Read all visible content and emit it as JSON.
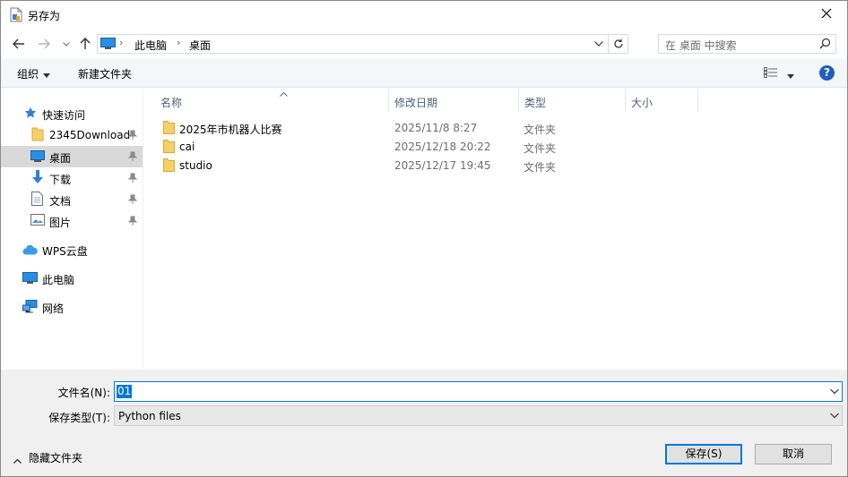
{
  "window": {
    "title": "另存为",
    "close_glyph": "✕"
  },
  "nav": {
    "back_icon": "arrow-left-icon",
    "forward_icon": "arrow-right-icon",
    "recent_icon": "chevron-down-icon",
    "up_icon": "arrow-up-icon"
  },
  "address": {
    "crumbs": [
      "此电脑",
      "桌面"
    ],
    "separator": "›"
  },
  "search": {
    "placeholder": "在 桌面 中搜索"
  },
  "toolbar": {
    "organize_label": "组织",
    "new_folder_label": "新建文件夹",
    "help_glyph": "?"
  },
  "sidebar": {
    "items": [
      {
        "label": "快速访问",
        "icon": "star-icon",
        "pinned": false
      },
      {
        "label": "2345Download",
        "icon": "folder-icon",
        "pinned": true
      },
      {
        "label": "桌面",
        "icon": "desktop-icon",
        "pinned": true,
        "selected": true
      },
      {
        "label": "下载",
        "icon": "download-icon",
        "pinned": true
      },
      {
        "label": "文档",
        "icon": "document-icon",
        "pinned": true
      },
      {
        "label": "图片",
        "icon": "picture-icon",
        "pinned": true
      },
      {
        "label": "WPS云盘",
        "icon": "cloud-icon",
        "pinned": false
      },
      {
        "label": "此电脑",
        "icon": "computer-icon",
        "pinned": false
      },
      {
        "label": "网络",
        "icon": "network-icon",
        "pinned": false
      }
    ]
  },
  "filelist": {
    "columns": [
      "名称",
      "修改日期",
      "类型",
      "大小"
    ],
    "rows": [
      {
        "name": "2025年市机器人比赛",
        "date": "2025/11/8 8:27",
        "type": "文件夹"
      },
      {
        "name": "cai",
        "date": "2025/12/18 20:22",
        "type": "文件夹"
      },
      {
        "name": "studio",
        "date": "2025/12/17 19:45",
        "type": "文件夹"
      }
    ]
  },
  "bottom": {
    "filename_label": "文件名(N):",
    "filename_value": "01",
    "filetype_label": "保存类型(T):",
    "filetype_value": "Python files",
    "hide_folders_label": "隐藏文件夹",
    "save_label": "保存(S)",
    "cancel_label": "取消"
  },
  "colors": {
    "accent": "#0078d7",
    "selected_bg": "#d9d9d9",
    "panel_bg": "#f0f0f0",
    "folder": "#f7cf68"
  }
}
